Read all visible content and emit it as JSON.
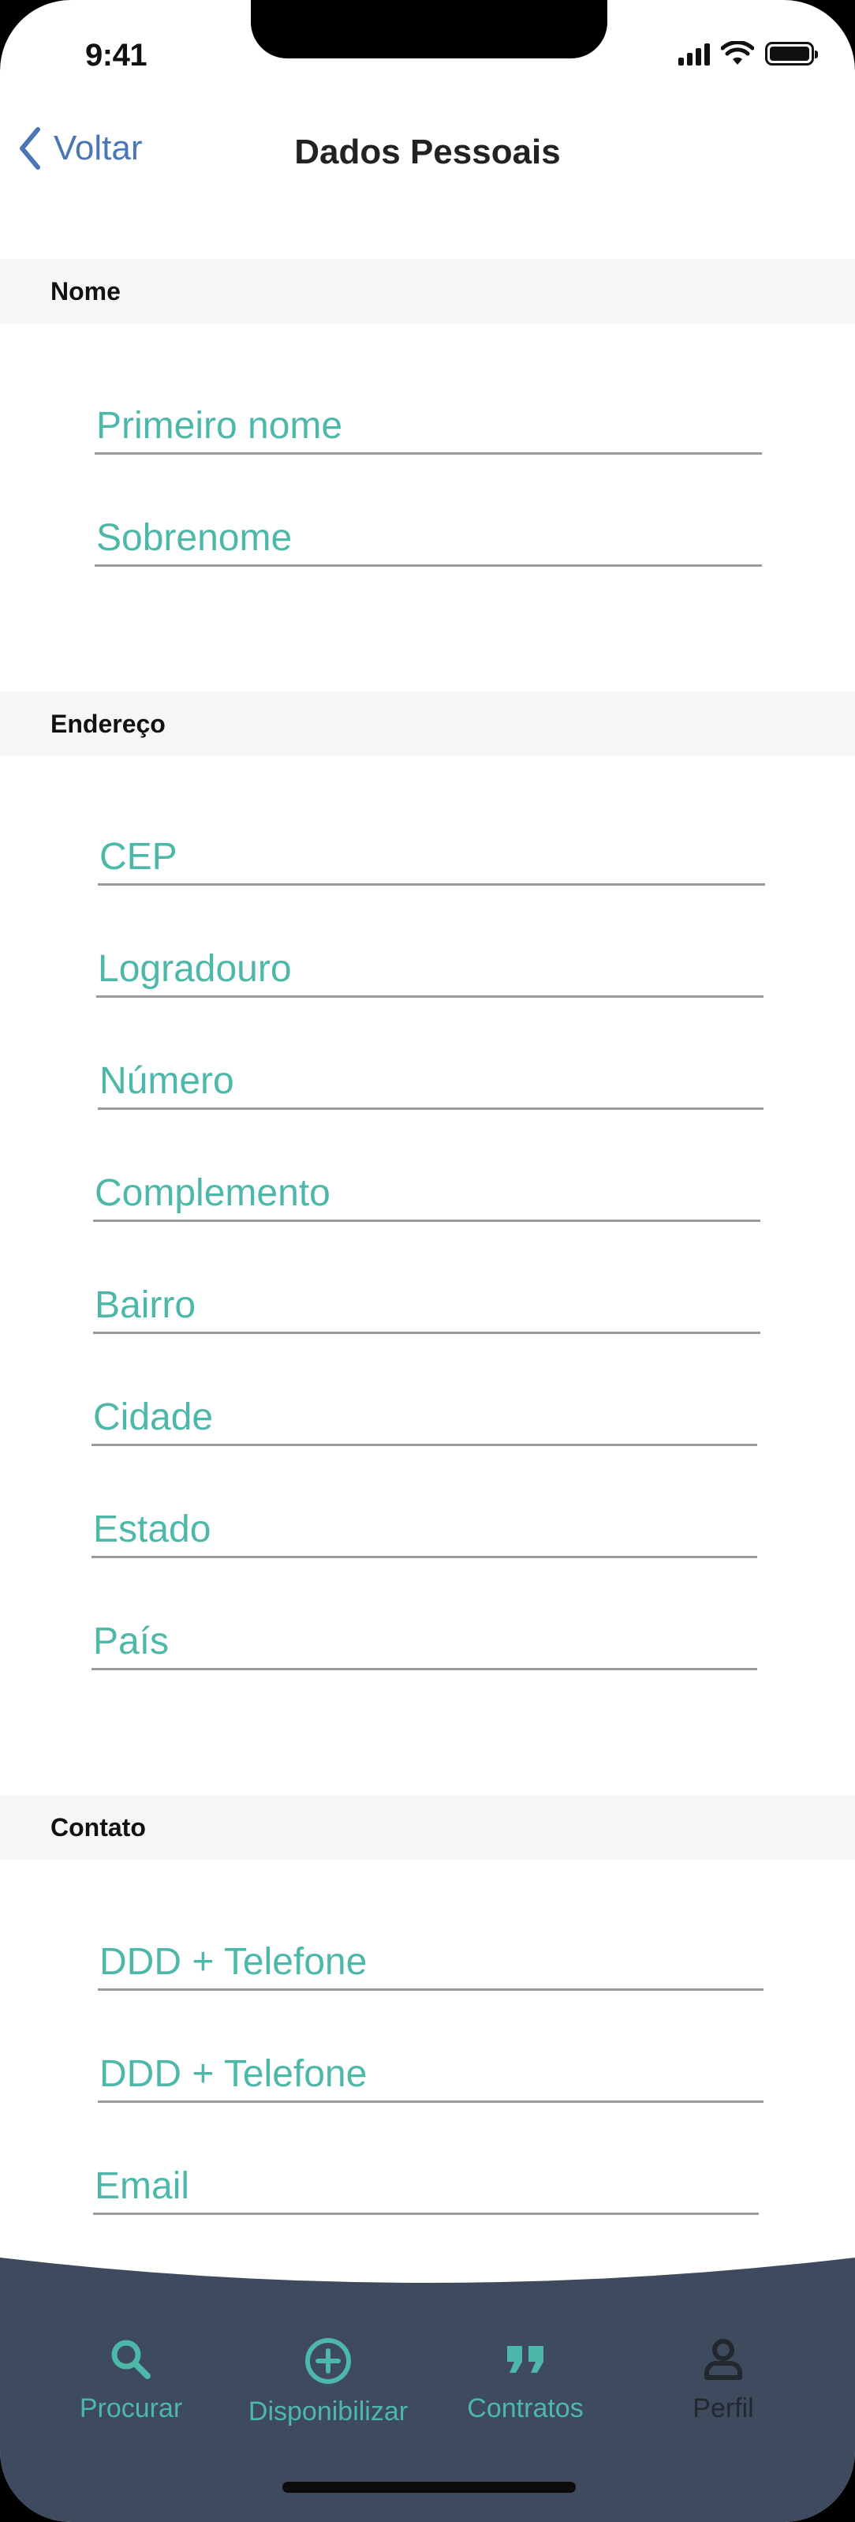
{
  "status_bar": {
    "time": "9:41"
  },
  "nav": {
    "back_label": "Voltar",
    "title": "Dados Pessoais"
  },
  "sections": {
    "nome": {
      "title": "Nome",
      "fields": {
        "primeiro_nome": "Primeiro nome",
        "sobrenome": "Sobrenome"
      }
    },
    "endereco": {
      "title": "Endereço",
      "fields": {
        "cep": "CEP",
        "logradouro": "Logradouro",
        "numero": "Número",
        "complemento": "Complemento",
        "bairro": "Bairro",
        "cidade": "Cidade",
        "estado": "Estado",
        "pais": "País"
      }
    },
    "contato": {
      "title": "Contato",
      "fields": {
        "telefone1": "DDD + Telefone",
        "telefone2": "DDD + Telefone",
        "email": "Email"
      }
    }
  },
  "tabbar": {
    "items": [
      {
        "label": "Procurar",
        "icon": "search-icon",
        "active": false
      },
      {
        "label": "Disponibilizar",
        "icon": "plus-circle-icon",
        "active": false
      },
      {
        "label": "Contratos",
        "icon": "quote-icon",
        "active": false
      },
      {
        "label": "Perfil",
        "icon": "person-icon",
        "active": true
      }
    ]
  },
  "colors": {
    "accent_teal": "#4db8aa",
    "back_blue": "#4a76b5",
    "tabbar_bg": "#3e4a5d",
    "section_bg": "#f6f6f6",
    "field_line": "#9a9a9a"
  }
}
